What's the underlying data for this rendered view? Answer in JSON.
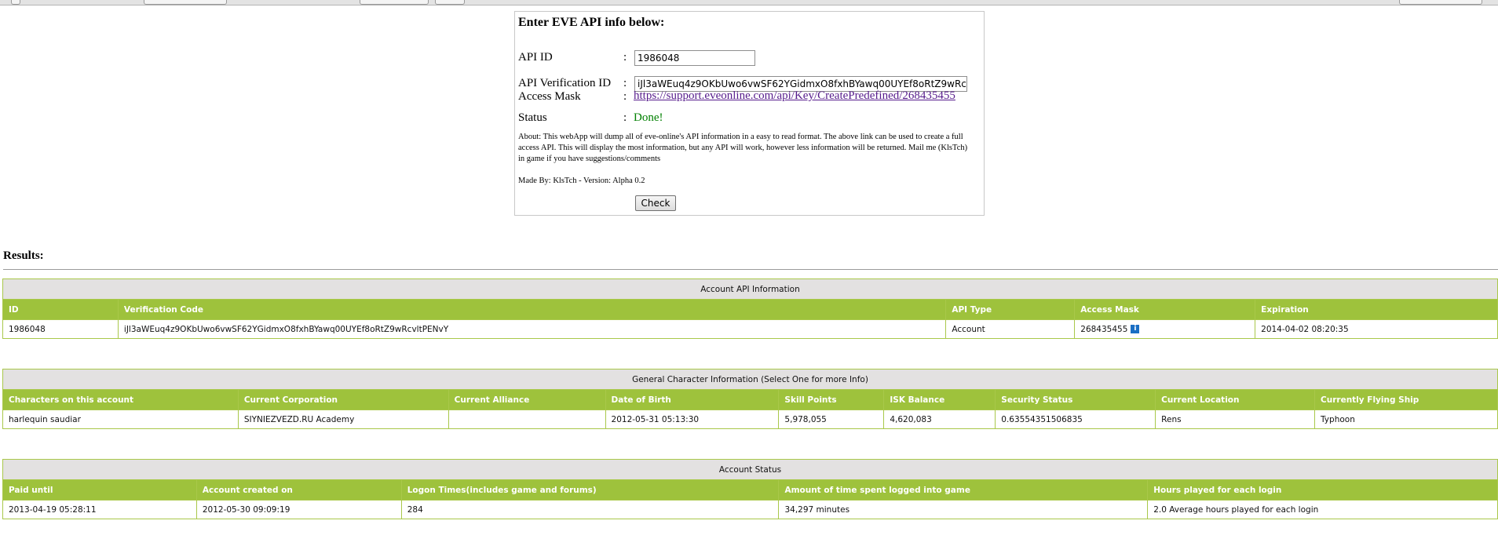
{
  "form": {
    "title": "Enter EVE API info below:",
    "api_id_label": "API ID",
    "api_id_value": "1986048",
    "verification_label": "API Verification ID",
    "verification_value": "iJl3aWEuq4z9OKbUwo6vwSF62YGidmxO8fxhBYawq00UYEf8oRtZ9wRcvltPENvY",
    "access_mask_label": "Access Mask",
    "access_mask_link": "https://support.eveonline.com/api/Key/CreatePredefined/268435455",
    "status_label": "Status",
    "status_value": "Done!",
    "colon": ":",
    "about": "About: This webApp will dump all of eve-online's API information in a easy to read format. The above link can be used to create a full access API. This will display the most information, but any API will work, however less information will be returned. Mail me (KlsTch) in game if you have suggestions/comments",
    "made_by": "Made By: KlsTch - Version: Alpha 0.2",
    "check_label": "Check"
  },
  "results": {
    "title": "Results:"
  },
  "account_api": {
    "caption": "Account API Information",
    "headers": [
      "ID",
      "Verification Code",
      "API Type",
      "Access Mask",
      "Expiration"
    ],
    "row": [
      "1986048",
      "iJl3aWEuq4z9OKbUwo6vwSF62YGidmxO8fxhBYawq00UYEf8oRtZ9wRcvltPENvY",
      "Account",
      "268435455",
      "2014-04-02 08:20:35"
    ],
    "info_icon": "i"
  },
  "characters": {
    "caption": "General Character Information (Select One for more Info)",
    "headers": [
      "Characters on this account",
      "Current Corporation",
      "Current Alliance",
      "Date of Birth",
      "Skill Points",
      "ISK Balance",
      "Security Status",
      "Current Location",
      "Currently Flying Ship"
    ],
    "row": [
      "harlequin saudiar",
      "SIYNIEZVEZD.RU Academy",
      "",
      "2012-05-31 05:13:30",
      "5,978,055",
      "4,620,083",
      "0.63554351506835",
      "Rens",
      "Typhoon"
    ]
  },
  "account_status": {
    "caption": "Account Status",
    "headers": [
      "Paid until",
      "Account created on",
      "Logon Times(includes game and forums)",
      "Amount of time spent logged into game",
      "Hours played for each login"
    ],
    "row": [
      "2013-04-19 05:28:11",
      "2012-05-30 09:09:19",
      "284",
      "34,297 minutes",
      "2.0 Average hours played for each login"
    ]
  },
  "colors": {
    "header_green": "#9ec23c",
    "caption_gray": "#e3e1e1",
    "status_green": "#008000",
    "link_purple": "#551a8b"
  }
}
